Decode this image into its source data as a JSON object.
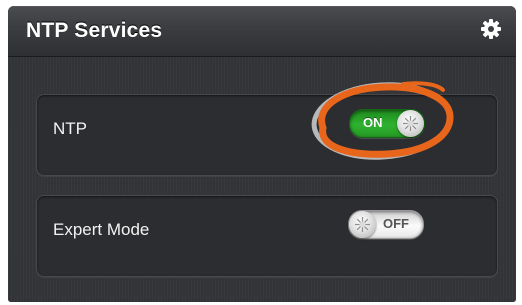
{
  "header": {
    "title": "NTP Services",
    "icon": "gear-icon"
  },
  "settings": [
    {
      "label": "NTP",
      "toggle_text": "ON",
      "state": "on"
    },
    {
      "label": "Expert Mode",
      "toggle_text": "OFF",
      "state": "off"
    }
  ],
  "colors": {
    "title_bar": "#3a3c40",
    "toggle_on": "#2fb22f",
    "highlight_ring": "#e8661c"
  }
}
